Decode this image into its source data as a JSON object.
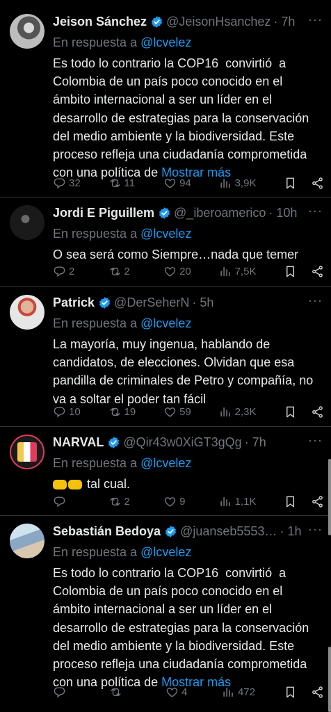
{
  "reply_label": "En respuesta a",
  "show_more_label": "Mostrar más",
  "tweets": [
    {
      "name": "Jeison Sánchez",
      "handle": "@JeisonHsanchez",
      "time": "· 7h",
      "reply_to": "@lcvelez",
      "text": "Es todo lo contrario la COP16  convirtió  a Colombia de un país poco conocido en el ámbito internacional a ser un líder en el desarrollo de estrategias para la conservación del medio ambiente y la biodiversidad. Este proceso refleja una ciudadanía comprometida con una política de ",
      "replies": "32",
      "reposts": "11",
      "likes": "94",
      "views": "3,9K"
    },
    {
      "name": "Jordi E Piguillem",
      "handle": "@_iberoamerico",
      "time": "· 10h",
      "reply_to": "@lcvelez",
      "text": "O sea será como Siempre…nada que temer",
      "replies": "2",
      "reposts": "2",
      "likes": "20",
      "views": "7,5K"
    },
    {
      "name": "Patrick",
      "handle": "@DerSeherN",
      "time": "· 5h",
      "reply_to": "@lcvelez",
      "text": "La mayoría, muy ingenua, hablando de candidatos, de elecciones. Olvidan que esa pandilla de criminales de Petro y compañía, no va a soltar el poder tan fácil",
      "replies": "10",
      "reposts": "19",
      "likes": "59",
      "views": "2,3K"
    },
    {
      "name": "NARVAL",
      "handle": "@Qir43w0XiGT3gQg",
      "time": "· 7h",
      "reply_to": "@lcvelez",
      "text": "tal cual.",
      "replies": "",
      "reposts": "2",
      "likes": "9",
      "views": "1,1K"
    },
    {
      "name": "Sebastián Bedoya",
      "handle": "@juanseb5553…",
      "time": "· 1h",
      "reply_to": "@lcvelez",
      "text": "Es todo lo contrario la COP16  convirtió  a Colombia de un país poco conocido en el ámbito internacional a ser un líder en el desarrollo de estrategias para la conservación del medio ambiente y la biodiversidad. Este proceso refleja una ciudadanía comprometida con una política de ",
      "replies": "",
      "reposts": "",
      "likes": "4",
      "views": "472"
    }
  ],
  "colors": {
    "accent": "#1d9bf0",
    "muted": "#71767b",
    "text": "#e7e9ea",
    "divider": "#2f3336"
  },
  "icons": [
    "verified-badge-icon",
    "more-icon",
    "reply-icon",
    "repost-icon",
    "like-icon",
    "views-icon",
    "bookmark-icon",
    "share-icon"
  ]
}
